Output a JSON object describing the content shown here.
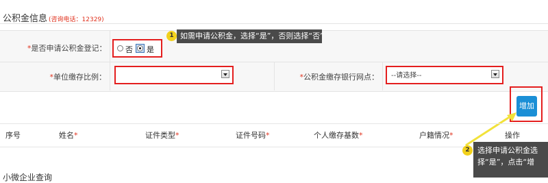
{
  "section": {
    "title": "公积金信息",
    "hotline": "(咨询电话：12329)"
  },
  "form": {
    "register_label": "是否申请公积金登记：",
    "radio_no": "否",
    "radio_yes": "是",
    "ratio_label": "单位缴存比例：",
    "ratio_value": "",
    "bank_label": "公积金缴存银行网点：",
    "bank_value": "--请选择--",
    "required_mark": "*"
  },
  "tips": {
    "tip1_num": "1",
    "tip1_text": "如需申请公积金，选择“是”，否则选择“否”",
    "tip2_num": "2",
    "tip2_text_line1": "选择申请公积金选",
    "tip2_text_line2": "择“是”，点击“增"
  },
  "actions": {
    "add_label": "增加"
  },
  "table": {
    "columns": [
      {
        "label": "序号",
        "required": ""
      },
      {
        "label": "姓名",
        "required": "*"
      },
      {
        "label": "证件类型",
        "required": "*"
      },
      {
        "label": "证件号码",
        "required": "*"
      },
      {
        "label": "个人缴存基数",
        "required": "*"
      },
      {
        "label": "户籍情况",
        "required": "*"
      },
      {
        "label": "操作",
        "required": ""
      }
    ]
  },
  "footer": {
    "next_section_partial": "小微企业查询"
  },
  "colors": {
    "accent_red": "#e41e1e",
    "button_blue": "#1a8fd6",
    "callout_bg": "#4a4a4a",
    "badge_yellow": "#f2d11c",
    "arrow_yellow": "#f2e23a"
  }
}
